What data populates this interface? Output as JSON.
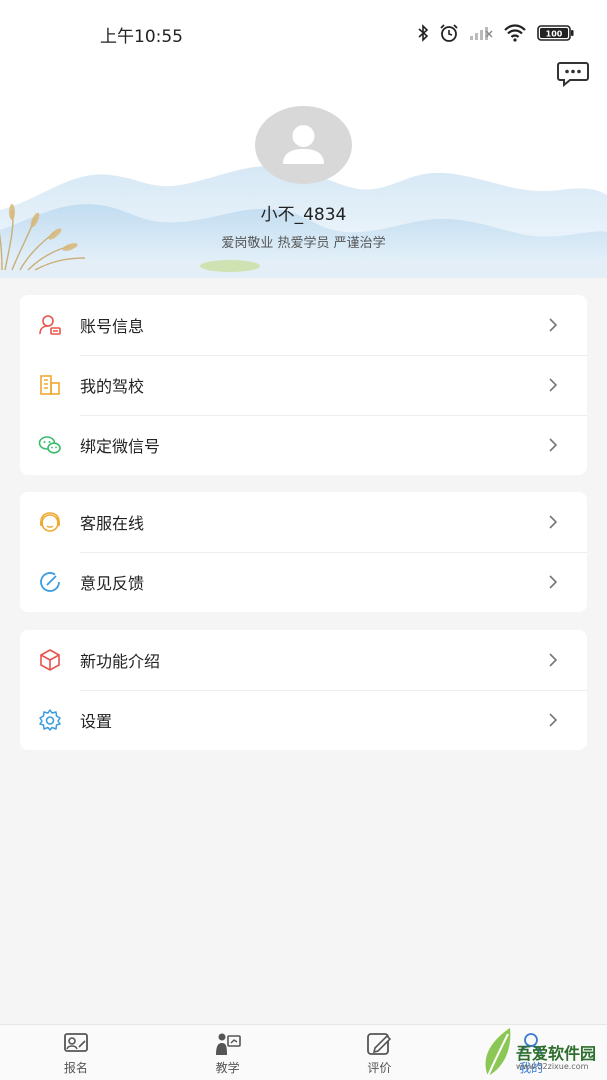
{
  "status_bar": {
    "time": "上午10:55",
    "battery": "100"
  },
  "profile": {
    "username": "小不_4834",
    "motto": "爱岗敬业 热爱学员 严谨治学"
  },
  "menu_groups": [
    {
      "items": [
        {
          "label": "账号信息",
          "icon": "account-info-icon"
        },
        {
          "label": "我的驾校",
          "icon": "driving-school-icon"
        },
        {
          "label": "绑定微信号",
          "icon": "wechat-icon"
        }
      ]
    },
    {
      "items": [
        {
          "label": "客服在线",
          "icon": "customer-service-icon"
        },
        {
          "label": "意见反馈",
          "icon": "feedback-icon"
        }
      ]
    },
    {
      "items": [
        {
          "label": "新功能介绍",
          "icon": "new-feature-icon"
        },
        {
          "label": "设置",
          "icon": "settings-icon"
        }
      ]
    }
  ],
  "bottom_nav": {
    "tabs": [
      {
        "label": "报名",
        "icon": "signup-icon"
      },
      {
        "label": "教学",
        "icon": "teaching-icon"
      },
      {
        "label": "评价",
        "icon": "review-icon"
      },
      {
        "label": "我的",
        "icon": "mine-icon"
      }
    ]
  },
  "watermark": {
    "title": "吾爱软件园",
    "url": "www.52zixue.com"
  },
  "colors": {
    "background": "#f5f5f5",
    "card": "#ffffff",
    "account_icon": "#e8534a",
    "school_icon": "#f0a830",
    "wechat_icon": "#3cba6b",
    "service_icon": "#f0a830",
    "feedback_icon": "#3a9de0",
    "feature_icon": "#e8534a",
    "settings_icon": "#3a9de0"
  }
}
